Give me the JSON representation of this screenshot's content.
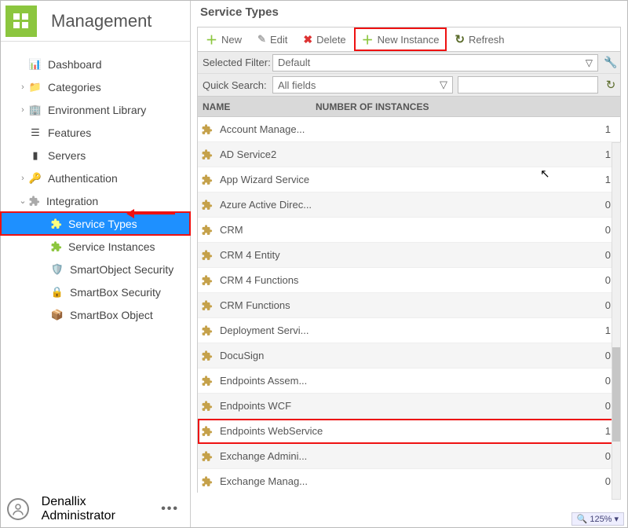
{
  "header": {
    "title": "Management"
  },
  "sidebar": {
    "items": [
      {
        "label": "Dashboard",
        "expander": ""
      },
      {
        "label": "Categories",
        "expander": "›"
      },
      {
        "label": "Environment Library",
        "expander": "›"
      },
      {
        "label": "Features",
        "expander": ""
      },
      {
        "label": "Servers",
        "expander": ""
      },
      {
        "label": "Authentication",
        "expander": "›"
      },
      {
        "label": "Integration",
        "expander": "⌄"
      }
    ],
    "integration_children": [
      {
        "label": "Service Types"
      },
      {
        "label": "Service Instances"
      },
      {
        "label": "SmartObject Security"
      },
      {
        "label": "SmartBox Security"
      },
      {
        "label": "SmartBox Object"
      }
    ],
    "footer_user": "Denallix Administrator"
  },
  "page": {
    "title": "Service Types"
  },
  "toolbar": {
    "new_label": "New",
    "edit_label": "Edit",
    "delete_label": "Delete",
    "newinstance_label": "New Instance",
    "refresh_label": "Refresh"
  },
  "filters": {
    "selected_label": "Selected Filter:",
    "selected_value": "Default",
    "quick_label": "Quick Search:",
    "quick_value": "All fields"
  },
  "grid": {
    "col_name": "NAME",
    "col_count": "NUMBER OF INSTANCES",
    "rows": [
      {
        "name": "Account Manage...",
        "count": 1
      },
      {
        "name": "AD Service2",
        "count": 1
      },
      {
        "name": "App Wizard Service",
        "count": 1
      },
      {
        "name": "Azure Active Direc...",
        "count": 0
      },
      {
        "name": "CRM",
        "count": 0
      },
      {
        "name": "CRM 4 Entity",
        "count": 0
      },
      {
        "name": "CRM 4 Functions",
        "count": 0
      },
      {
        "name": "CRM Functions",
        "count": 0
      },
      {
        "name": "Deployment Servi...",
        "count": 1
      },
      {
        "name": "DocuSign",
        "count": 0
      },
      {
        "name": "Endpoints Assem...",
        "count": 0
      },
      {
        "name": "Endpoints WCF",
        "count": 0
      },
      {
        "name": "Endpoints WebService",
        "count": 1,
        "highlight": true
      },
      {
        "name": "Exchange Admini...",
        "count": 0
      },
      {
        "name": "Exchange Manag...",
        "count": 0
      }
    ]
  },
  "zoom_label": "125%"
}
